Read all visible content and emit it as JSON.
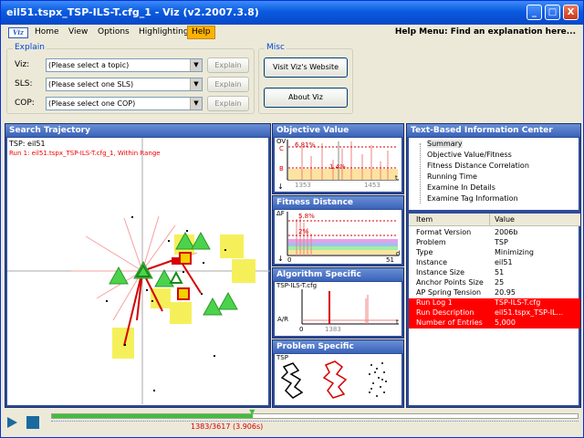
{
  "window": {
    "title": "eil51.tspx_TSP-ILS-T.cfg_1 - Viz (v2.2007.3.8)",
    "minimize": "_",
    "maximize": "□",
    "close": "X"
  },
  "menu": {
    "logo": "Viz",
    "items": [
      "Home",
      "View",
      "Options",
      "Highlighting",
      "Help"
    ],
    "help_message": "Help Menu: Find an explanation here..."
  },
  "explain": {
    "caption": "Explain",
    "rows": [
      {
        "label": "Viz:",
        "value": "(Please select a topic)",
        "button": "Explain"
      },
      {
        "label": "SLS:",
        "value": "(Please select one SLS)",
        "button": "Explain"
      },
      {
        "label": "COP:",
        "value": "(Please select one COP)",
        "button": "Explain"
      }
    ]
  },
  "misc": {
    "caption": "Misc",
    "website_button": "Visit Viz's Website",
    "about_button": "About Viz"
  },
  "search": {
    "title": "Search Trajectory",
    "instance": "TSP: eil51",
    "run": "Run 1: eil51.tspx_TSP-ILS-T.cfg_1, Within Range"
  },
  "objective": {
    "title": "Objective Value",
    "y_label": "OV",
    "c_label": "C",
    "b_label": "B",
    "pct_top": "6.81%",
    "pct_low": "1.4%",
    "x_left": "1353",
    "x_right": "1453",
    "t_label": "t"
  },
  "fdc": {
    "title": "Fitness Distance Correlation",
    "y_label": "ΔF",
    "pct_top": "5.8%",
    "pct_low": "2%",
    "x_left": "0",
    "x_right": "51",
    "d_label": "d"
  },
  "algo": {
    "title": "Algorithm Specific",
    "cfg": "TSP-ILS-T.cfg",
    "y_label": "A/R",
    "x_mark": "1383",
    "x_zero": "0",
    "t_label": "t"
  },
  "problem": {
    "title": "Problem Specific",
    "label": "TSP"
  },
  "info": {
    "title": "Text-Based Information Center",
    "tree": [
      "Summary",
      "Objective Value/Fitness",
      "Fitness Distance Correlation",
      "Running Time",
      "Examine In Details",
      "Examine Tag Information"
    ],
    "columns": [
      "Item",
      "Value"
    ],
    "rows": [
      {
        "item": "Format Version",
        "value": "2006b",
        "hl": false
      },
      {
        "item": "Problem",
        "value": "TSP",
        "hl": false
      },
      {
        "item": "Type",
        "value": "Minimizing",
        "hl": false
      },
      {
        "item": "Instance",
        "value": "eil51",
        "hl": false
      },
      {
        "item": "Instance Size",
        "value": "51",
        "hl": false
      },
      {
        "item": "Anchor Points Size",
        "value": "25",
        "hl": false
      },
      {
        "item": "AP Spring Tension",
        "value": "20.95",
        "hl": false
      },
      {
        "item": "Run Log 1",
        "value": "TSP-ILS-T.cfg",
        "hl": true
      },
      {
        "item": "Run Description",
        "value": "eil51.tspx_TSP-IL...",
        "hl": true
      },
      {
        "item": "Number of Entries",
        "value": "5,000",
        "hl": true
      }
    ]
  },
  "player": {
    "position_text": "1383/3617 (3.906s)",
    "progress": 0.3823,
    "accent": "#3fbf3f"
  }
}
